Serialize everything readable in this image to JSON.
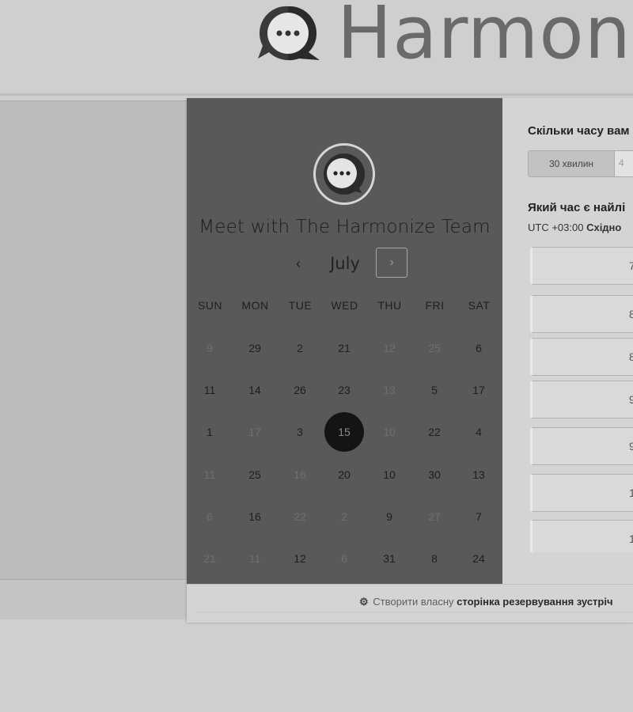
{
  "header": {
    "brand": "Harmon"
  },
  "calendar": {
    "title": "Meet with The Harmonize Team",
    "month": "July",
    "prev_icon": "‹",
    "next_icon": "›",
    "dow": [
      "SUN",
      "MON",
      "TUE",
      "WED",
      "THU",
      "FRI",
      "SAT"
    ],
    "weeks": [
      [
        {
          "d": "9",
          "m": true
        },
        {
          "d": "29"
        },
        {
          "d": "2"
        },
        {
          "d": "21"
        },
        {
          "d": "12",
          "m": true
        },
        {
          "d": "25",
          "m": true
        },
        {
          "d": "6"
        }
      ],
      [
        {
          "d": "11"
        },
        {
          "d": "14"
        },
        {
          "d": "26"
        },
        {
          "d": "23"
        },
        {
          "d": "13",
          "m": true
        },
        {
          "d": "5"
        },
        {
          "d": "17"
        }
      ],
      [
        {
          "d": "1"
        },
        {
          "d": "17",
          "m": true
        },
        {
          "d": "3"
        },
        {
          "d": "15",
          "sel": true
        },
        {
          "d": "10",
          "m": true
        },
        {
          "d": "22"
        },
        {
          "d": "4"
        }
      ],
      [
        {
          "d": "11",
          "m": true
        },
        {
          "d": "25"
        },
        {
          "d": "16",
          "m": true
        },
        {
          "d": "20"
        },
        {
          "d": "10"
        },
        {
          "d": "30"
        },
        {
          "d": "13"
        }
      ],
      [
        {
          "d": "6",
          "m": true
        },
        {
          "d": "16"
        },
        {
          "d": "22",
          "m": true
        },
        {
          "d": "2",
          "m": true
        },
        {
          "d": "9"
        },
        {
          "d": "27",
          "m": true
        },
        {
          "d": "7"
        }
      ],
      [
        {
          "d": "21",
          "m": true
        },
        {
          "d": "11",
          "m": true
        },
        {
          "d": "12"
        },
        {
          "d": "6",
          "m": true
        },
        {
          "d": "31"
        },
        {
          "d": "8"
        },
        {
          "d": "24"
        }
      ]
    ]
  },
  "booking": {
    "duration_question": "Скільки часу вам",
    "duration_options": [
      "30 хвилин",
      "4"
    ],
    "time_question": "Який час є найлі",
    "timezone_prefix": "UTC +03:00",
    "timezone_name": "Східно",
    "slots": [
      "7",
      "8",
      "8",
      "9",
      "9",
      "1",
      "1"
    ]
  },
  "footer": {
    "prefix": "Створити власну",
    "link": "сторінка резервування зустріч"
  }
}
